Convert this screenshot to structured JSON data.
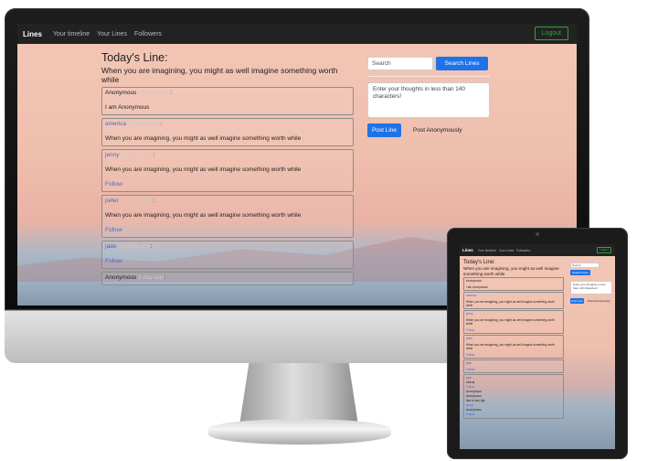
{
  "nav": {
    "brand": "Lines",
    "links": [
      "Your timeline",
      "Your Lines",
      "Followers"
    ],
    "logout": "Logout"
  },
  "feed": {
    "title": "Today's Line:",
    "quote": "When you are imagining, you might as well imagine something worth while",
    "posts": [
      {
        "user": "Anonymous",
        "time": "20 mins ago",
        "text": "I am Anonymous",
        "follow": ""
      },
      {
        "user": "america",
        "time": "20 mins ago",
        "text": "When you are imagining, you might as well imagine something worth while",
        "follow": ""
      },
      {
        "user": "jenny",
        "time": "21 mins ago",
        "text": "When you are imagining, you might as well imagine something worth while",
        "follow": "Follow"
      },
      {
        "user": "peter",
        "time": "21 mins ago",
        "text": "When you are imagining, you might as well imagine something worth while",
        "follow": "Follow"
      },
      {
        "user": "jade",
        "time": "32 mins ago",
        "text": "",
        "follow": "Follow"
      },
      {
        "user": "Anonymous",
        "time": "1 day ago",
        "text": "",
        "follow": ""
      }
    ]
  },
  "sidebar": {
    "search_placeholder": "Search",
    "search_button": "Search Lines",
    "thought_placeholder": "Enter your thoughts in less than 140 characters!",
    "post_button": "Post Line",
    "post_anon": "Post Anonymously"
  },
  "tablet": {
    "extra_rows": [
      "jade",
      "ethical",
      "Follow",
      "Anonymous",
      "Anonymous",
      "this is nice ldjk",
      "jenny",
      "Anonymous",
      "Follow"
    ]
  },
  "colors": {
    "accent": "#1e73e8",
    "link": "#3b6fd8",
    "logout": "#28a745",
    "navbar": "#222222"
  }
}
